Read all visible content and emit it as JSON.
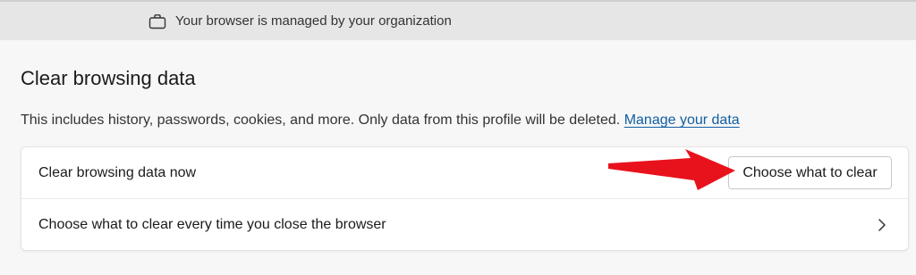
{
  "managed_bar": {
    "icon": "briefcase-icon",
    "text": "Your browser is managed by your organization"
  },
  "section": {
    "title": "Clear browsing data",
    "description": "This includes history, passwords, cookies, and more. Only data from this profile will be deleted.",
    "link_label": "Manage your data"
  },
  "rows": [
    {
      "label": "Clear browsing data now",
      "button_label": "Choose what to clear"
    },
    {
      "label": "Choose what to clear every time you close the browser",
      "icon": "chevron-right-icon"
    }
  ],
  "annotation": {
    "icon": "red-arrow-icon",
    "color": "#e8121d"
  },
  "colors": {
    "link": "#115ea3",
    "managed_bar_bg": "#e6e6e6",
    "page_bg": "#f7f7f7"
  }
}
